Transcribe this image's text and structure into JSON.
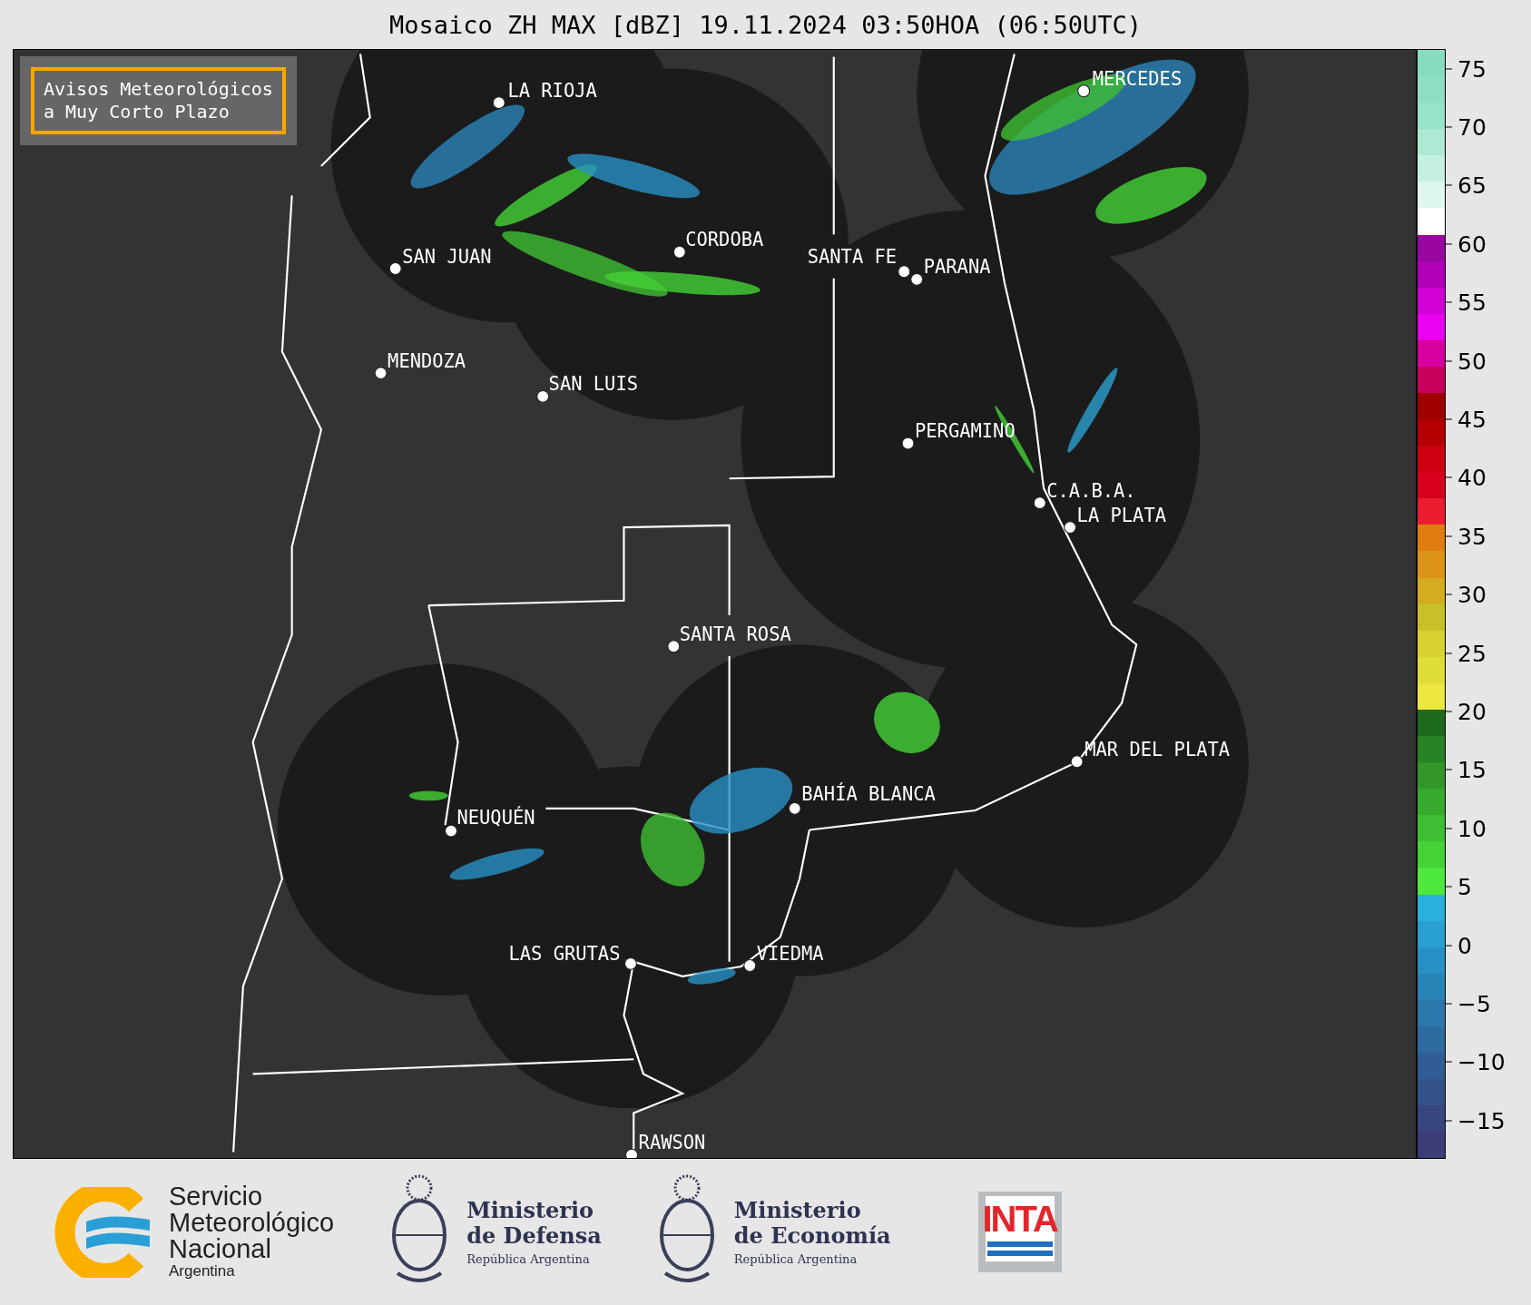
{
  "title": "Mosaico ZH MAX [dBZ] 19.11.2024 03:50HOA (06:50UTC)",
  "notice": {
    "lines": [
      "Avisos Meteorológicos",
      "a Muy Corto Plazo"
    ]
  },
  "cities": [
    {
      "name": "LA RIOJA"
    },
    {
      "name": "MERCEDES"
    },
    {
      "name": "CORDOBA"
    },
    {
      "name": "SAN JUAN"
    },
    {
      "name": "SANTA FE"
    },
    {
      "name": "PARANA"
    },
    {
      "name": "MENDOZA"
    },
    {
      "name": "SAN LUIS"
    },
    {
      "name": "PERGAMINO"
    },
    {
      "name": "C.A.B.A."
    },
    {
      "name": "LA PLATA"
    },
    {
      "name": "SANTA ROSA"
    },
    {
      "name": "MAR DEL PLATA"
    },
    {
      "name": "BAHÍA BLANCA"
    },
    {
      "name": "NEUQUÉN"
    },
    {
      "name": "LAS GRUTAS"
    },
    {
      "name": "VIEDMA"
    },
    {
      "name": "RAWSON"
    }
  ],
  "colorbar": {
    "ticks": [
      "75",
      "70",
      "65",
      "60",
      "55",
      "50",
      "45",
      "40",
      "35",
      "30",
      "25",
      "20",
      "15",
      "10",
      "5",
      "0",
      "−5",
      "−10",
      "−15"
    ]
  },
  "footer": {
    "logos": [
      {
        "kind": "smn",
        "lines": [
          "Servicio",
          "Meteorológico",
          "Nacional"
        ],
        "sub": "Argentina"
      },
      {
        "kind": "ministry",
        "lines": [
          "Ministerio",
          "de Defensa"
        ],
        "sub": "República Argentina"
      },
      {
        "kind": "ministry",
        "lines": [
          "Ministerio",
          "de Economía"
        ],
        "sub": "República Argentina"
      },
      {
        "kind": "inta",
        "lines": [
          "INTA"
        ]
      }
    ]
  }
}
